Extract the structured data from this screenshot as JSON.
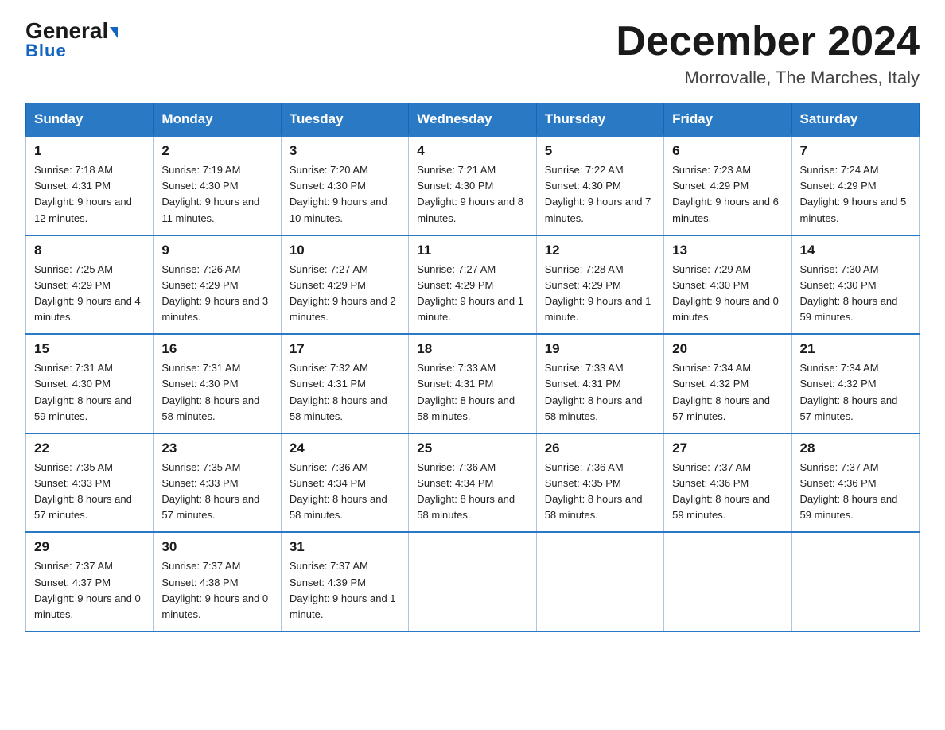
{
  "header": {
    "logo_general": "General",
    "logo_blue": "Blue",
    "month_title": "December 2024",
    "location": "Morrovalle, The Marches, Italy"
  },
  "days_of_week": [
    "Sunday",
    "Monday",
    "Tuesday",
    "Wednesday",
    "Thursday",
    "Friday",
    "Saturday"
  ],
  "weeks": [
    [
      {
        "day": "1",
        "sunrise": "7:18 AM",
        "sunset": "4:31 PM",
        "daylight": "9 hours and 12 minutes."
      },
      {
        "day": "2",
        "sunrise": "7:19 AM",
        "sunset": "4:30 PM",
        "daylight": "9 hours and 11 minutes."
      },
      {
        "day": "3",
        "sunrise": "7:20 AM",
        "sunset": "4:30 PM",
        "daylight": "9 hours and 10 minutes."
      },
      {
        "day": "4",
        "sunrise": "7:21 AM",
        "sunset": "4:30 PM",
        "daylight": "9 hours and 8 minutes."
      },
      {
        "day": "5",
        "sunrise": "7:22 AM",
        "sunset": "4:30 PM",
        "daylight": "9 hours and 7 minutes."
      },
      {
        "day": "6",
        "sunrise": "7:23 AM",
        "sunset": "4:29 PM",
        "daylight": "9 hours and 6 minutes."
      },
      {
        "day": "7",
        "sunrise": "7:24 AM",
        "sunset": "4:29 PM",
        "daylight": "9 hours and 5 minutes."
      }
    ],
    [
      {
        "day": "8",
        "sunrise": "7:25 AM",
        "sunset": "4:29 PM",
        "daylight": "9 hours and 4 minutes."
      },
      {
        "day": "9",
        "sunrise": "7:26 AM",
        "sunset": "4:29 PM",
        "daylight": "9 hours and 3 minutes."
      },
      {
        "day": "10",
        "sunrise": "7:27 AM",
        "sunset": "4:29 PM",
        "daylight": "9 hours and 2 minutes."
      },
      {
        "day": "11",
        "sunrise": "7:27 AM",
        "sunset": "4:29 PM",
        "daylight": "9 hours and 1 minute."
      },
      {
        "day": "12",
        "sunrise": "7:28 AM",
        "sunset": "4:29 PM",
        "daylight": "9 hours and 1 minute."
      },
      {
        "day": "13",
        "sunrise": "7:29 AM",
        "sunset": "4:30 PM",
        "daylight": "9 hours and 0 minutes."
      },
      {
        "day": "14",
        "sunrise": "7:30 AM",
        "sunset": "4:30 PM",
        "daylight": "8 hours and 59 minutes."
      }
    ],
    [
      {
        "day": "15",
        "sunrise": "7:31 AM",
        "sunset": "4:30 PM",
        "daylight": "8 hours and 59 minutes."
      },
      {
        "day": "16",
        "sunrise": "7:31 AM",
        "sunset": "4:30 PM",
        "daylight": "8 hours and 58 minutes."
      },
      {
        "day": "17",
        "sunrise": "7:32 AM",
        "sunset": "4:31 PM",
        "daylight": "8 hours and 58 minutes."
      },
      {
        "day": "18",
        "sunrise": "7:33 AM",
        "sunset": "4:31 PM",
        "daylight": "8 hours and 58 minutes."
      },
      {
        "day": "19",
        "sunrise": "7:33 AM",
        "sunset": "4:31 PM",
        "daylight": "8 hours and 58 minutes."
      },
      {
        "day": "20",
        "sunrise": "7:34 AM",
        "sunset": "4:32 PM",
        "daylight": "8 hours and 57 minutes."
      },
      {
        "day": "21",
        "sunrise": "7:34 AM",
        "sunset": "4:32 PM",
        "daylight": "8 hours and 57 minutes."
      }
    ],
    [
      {
        "day": "22",
        "sunrise": "7:35 AM",
        "sunset": "4:33 PM",
        "daylight": "8 hours and 57 minutes."
      },
      {
        "day": "23",
        "sunrise": "7:35 AM",
        "sunset": "4:33 PM",
        "daylight": "8 hours and 57 minutes."
      },
      {
        "day": "24",
        "sunrise": "7:36 AM",
        "sunset": "4:34 PM",
        "daylight": "8 hours and 58 minutes."
      },
      {
        "day": "25",
        "sunrise": "7:36 AM",
        "sunset": "4:34 PM",
        "daylight": "8 hours and 58 minutes."
      },
      {
        "day": "26",
        "sunrise": "7:36 AM",
        "sunset": "4:35 PM",
        "daylight": "8 hours and 58 minutes."
      },
      {
        "day": "27",
        "sunrise": "7:37 AM",
        "sunset": "4:36 PM",
        "daylight": "8 hours and 59 minutes."
      },
      {
        "day": "28",
        "sunrise": "7:37 AM",
        "sunset": "4:36 PM",
        "daylight": "8 hours and 59 minutes."
      }
    ],
    [
      {
        "day": "29",
        "sunrise": "7:37 AM",
        "sunset": "4:37 PM",
        "daylight": "9 hours and 0 minutes."
      },
      {
        "day": "30",
        "sunrise": "7:37 AM",
        "sunset": "4:38 PM",
        "daylight": "9 hours and 0 minutes."
      },
      {
        "day": "31",
        "sunrise": "7:37 AM",
        "sunset": "4:39 PM",
        "daylight": "9 hours and 1 minute."
      },
      null,
      null,
      null,
      null
    ]
  ]
}
